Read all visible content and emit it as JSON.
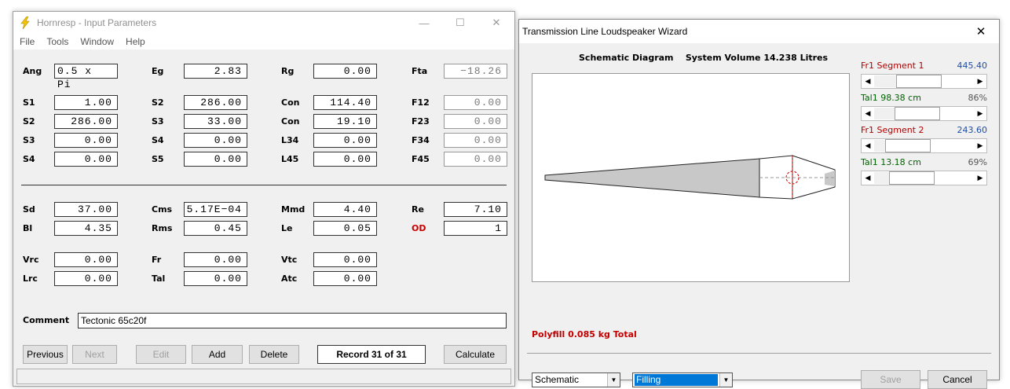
{
  "win1": {
    "title": "Hornresp - Input Parameters",
    "menu": [
      "File",
      "Tools",
      "Window",
      "Help"
    ],
    "rows": {
      "ang": {
        "label": "Ang",
        "value": "0.5 x Pi"
      },
      "eg": {
        "label": "Eg",
        "value": "2.83"
      },
      "rg": {
        "label": "Rg",
        "value": "0.00"
      },
      "fta": {
        "label": "Fta",
        "value": "−18.26"
      },
      "s1": {
        "label": "S1",
        "value": "1.00"
      },
      "s2a": {
        "label": "S2",
        "value": "286.00"
      },
      "con1": {
        "label": "Con",
        "value": "114.40"
      },
      "f12": {
        "label": "F12",
        "value": "0.00"
      },
      "s2b": {
        "label": "S2",
        "value": "286.00"
      },
      "s3a": {
        "label": "S3",
        "value": "33.00"
      },
      "con2": {
        "label": "Con",
        "value": "19.10"
      },
      "f23": {
        "label": "F23",
        "value": "0.00"
      },
      "s3b": {
        "label": "S3",
        "value": "0.00"
      },
      "s4a": {
        "label": "S4",
        "value": "0.00"
      },
      "l34": {
        "label": "L34",
        "value": "0.00"
      },
      "f34": {
        "label": "F34",
        "value": "0.00"
      },
      "s4b": {
        "label": "S4",
        "value": "0.00"
      },
      "s5": {
        "label": "S5",
        "value": "0.00"
      },
      "l45": {
        "label": "L45",
        "value": "0.00"
      },
      "f45": {
        "label": "F45",
        "value": "0.00"
      },
      "sd": {
        "label": "Sd",
        "value": "37.00"
      },
      "cms": {
        "label": "Cms",
        "value": "5.17E−04"
      },
      "mmd": {
        "label": "Mmd",
        "value": "4.40"
      },
      "re": {
        "label": "Re",
        "value": "7.10"
      },
      "bl": {
        "label": "Bl",
        "value": "4.35"
      },
      "rms": {
        "label": "Rms",
        "value": "0.45"
      },
      "le": {
        "label": "Le",
        "value": "0.05"
      },
      "od": {
        "label": "OD",
        "value": "1"
      },
      "vrc": {
        "label": "Vrc",
        "value": "0.00"
      },
      "fr": {
        "label": "Fr",
        "value": "0.00"
      },
      "vtc": {
        "label": "Vtc",
        "value": "0.00"
      },
      "lrc": {
        "label": "Lrc",
        "value": "0.00"
      },
      "tal": {
        "label": "Tal",
        "value": "0.00"
      },
      "atc": {
        "label": "Atc",
        "value": "0.00"
      }
    },
    "comment_label": "Comment",
    "comment_value": "Tectonic 65c20f",
    "buttons": {
      "previous": "Previous",
      "next": "Next",
      "edit": "Edit",
      "add": "Add",
      "delete": "Delete",
      "calculate": "Calculate"
    },
    "record": "Record 31 of 31"
  },
  "win2": {
    "title": "Transmission Line Loudspeaker Wizard",
    "schematic_title": "Schematic Diagram",
    "system_volume": "System Volume 14.238 Litres",
    "seg1_label": "Fr1  Segment 1",
    "seg1_value": "445.40",
    "seg1_scroll": 0.4,
    "tal1a_label": "Tal1  98.38 cm",
    "tal1a_value": "86%",
    "tal1a_scroll": 0.38,
    "seg2_label": "Fr1  Segment 2",
    "seg2_value": "243.60",
    "seg2_scroll": 0.2,
    "tal1b_label": "Tal1  13.18 cm",
    "tal1b_value": "69%",
    "tal1b_scroll": 0.27,
    "polyfill": "Polyfill   0.085 kg   Total",
    "view_select": "Schematic",
    "mode_select": "Filling",
    "save": "Save",
    "cancel": "Cancel"
  },
  "colors": {
    "label_red": "#cc0000",
    "fill_gray": "#c8c8c8",
    "select_blue": "#0078d7",
    "value_blue": "#1f4ea8"
  }
}
